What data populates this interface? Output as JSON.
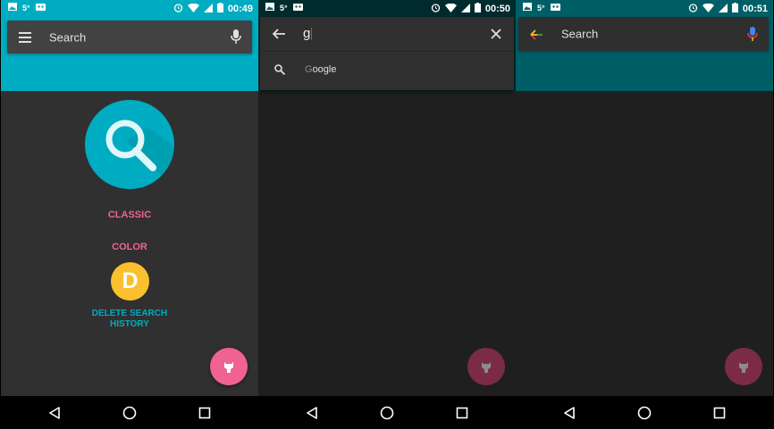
{
  "status_bar": {
    "temp": "5°",
    "times": [
      "00:49",
      "00:50",
      "00:51"
    ]
  },
  "screen1": {
    "search_placeholder": "Search",
    "menu": {
      "classic": "CLASSIC",
      "color": "COLOR",
      "delete_initial": "D",
      "delete_line1": "DELETE SEARCH",
      "delete_line2": "HISTORY"
    }
  },
  "screen2": {
    "query": "g",
    "suggestion_typed": "G",
    "suggestion_rest": "oogle"
  },
  "screen3": {
    "search_placeholder": "Search"
  },
  "icons": [
    "menu-icon",
    "mic-icon",
    "back-arrow-icon",
    "close-icon",
    "search-icon",
    "github-icon",
    "nav-back-icon",
    "nav-home-icon",
    "nav-recents-icon"
  ],
  "colors": {
    "accent_cyan": "#00acc1",
    "pink": "#f06292",
    "yellow": "#fbc02d",
    "fab_dim": "#7b2b45"
  }
}
